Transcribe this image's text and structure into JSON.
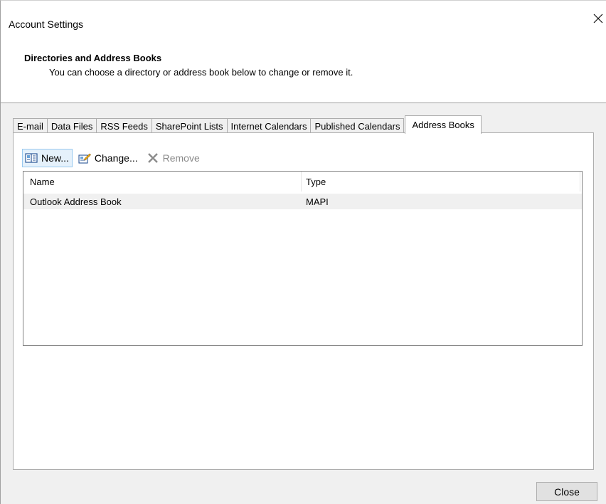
{
  "window": {
    "title": "Account Settings"
  },
  "header": {
    "heading": "Directories and Address Books",
    "description": "You can choose a directory or address book below to change or remove it."
  },
  "tabs": [
    {
      "label": "E-mail",
      "active": false
    },
    {
      "label": "Data Files",
      "active": false
    },
    {
      "label": "RSS Feeds",
      "active": false
    },
    {
      "label": "SharePoint Lists",
      "active": false
    },
    {
      "label": "Internet Calendars",
      "active": false
    },
    {
      "label": "Published Calendars",
      "active": false
    },
    {
      "label": "Address Books",
      "active": true
    }
  ],
  "toolbar": {
    "new_label": "New...",
    "new_icon": "address-book-icon",
    "change_label": "Change...",
    "change_icon": "edit-icon",
    "remove_label": "Remove",
    "remove_icon": "remove-icon"
  },
  "list": {
    "columns": [
      "Name",
      "Type"
    ],
    "rows": [
      {
        "name": "Outlook Address Book",
        "type": "MAPI"
      }
    ]
  },
  "footer": {
    "close_label": "Close"
  },
  "colors": {
    "hover_bg": "#e5f1fb",
    "hover_border": "#99c9ef",
    "panel_bg": "#f0f0f0"
  }
}
